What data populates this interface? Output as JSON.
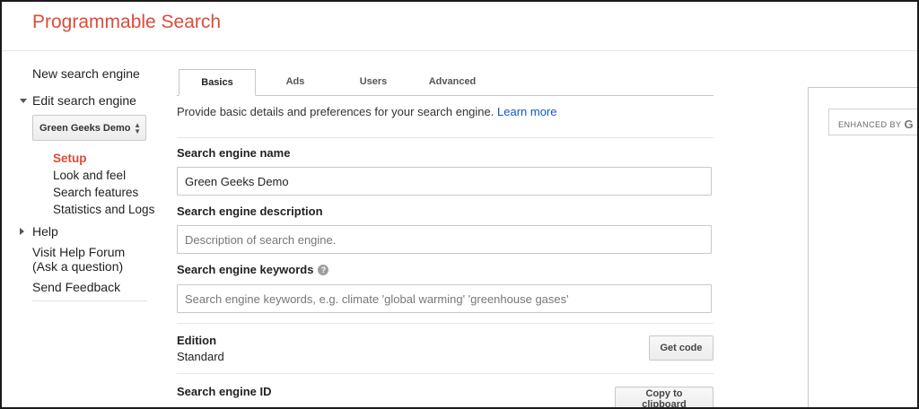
{
  "header": {
    "title": "Programmable Search"
  },
  "sidebar": {
    "new_engine": "New search engine",
    "edit_engine": "Edit search engine",
    "selected_engine": "Green Geeks Demo",
    "sub_items": [
      "Setup",
      "Look and feel",
      "Search features",
      "Statistics and Logs"
    ],
    "help": "Help",
    "help_forum_line1": "Visit Help Forum",
    "help_forum_line2": "(Ask a question)",
    "feedback": "Send Feedback"
  },
  "tabs": [
    {
      "label": "Basics",
      "active": true
    },
    {
      "label": "Ads",
      "active": false
    },
    {
      "label": "Users",
      "active": false
    },
    {
      "label": "Advanced",
      "active": false
    }
  ],
  "main": {
    "intro_text": "Provide basic details and preferences for your search engine.",
    "intro_link": "Learn more",
    "name_label": "Search engine name",
    "name_value": "Green Geeks Demo",
    "description_label": "Search engine description",
    "description_placeholder": "Description of search engine.",
    "keywords_label": "Search engine keywords",
    "keywords_placeholder": "Search engine keywords, e.g. climate 'global warming' 'greenhouse gases'",
    "help_glyph": "?",
    "edition_label": "Edition",
    "edition_value": "Standard",
    "get_code_button": "Get code",
    "engine_id_label": "Search engine ID",
    "copy_button": "Copy to clipboard"
  },
  "preview": {
    "enhanced_by": "ENHANCED BY",
    "brand_glyph": "G"
  },
  "colors": {
    "brand_red": "#dd4b39",
    "link_blue": "#1155cc"
  }
}
